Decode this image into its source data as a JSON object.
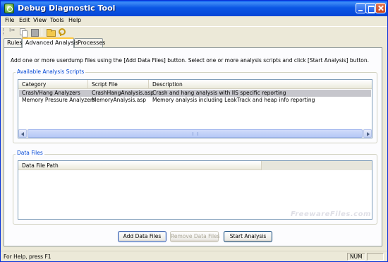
{
  "window": {
    "title": "Debug Diagnostic Tool"
  },
  "menu": [
    "File",
    "Edit",
    "View",
    "Tools",
    "Help"
  ],
  "toolbar": {
    "icons": [
      "cut-icon",
      "copy-icon",
      "paste-icon",
      "open-folder-icon",
      "key-icon"
    ]
  },
  "tabs": [
    "Rules",
    "Advanced Analysis",
    "Processes"
  ],
  "active_tab": "Advanced Analysis",
  "instructions": "Add one or more userdump files using the [Add Data Files] button. Select one or more analysis scripts and click [Start Analysis] button.",
  "scripts_group": {
    "label": "Available Analysis Scripts",
    "columns": [
      "Category",
      "Script File",
      "Description"
    ],
    "rows": [
      {
        "category": "Crash/Hang Analyzers",
        "script": "CrashHangAnalysis.asp",
        "description": "Crash and hang analysis with IIS specific reporting",
        "selected": true
      },
      {
        "category": "Memory Pressure Analyzers",
        "script": "MemoryAnalysis.asp",
        "description": "Memory analysis including LeakTrack and heap info reporting",
        "selected": false
      }
    ]
  },
  "files_group": {
    "label": "Data Files",
    "columns": [
      "Data File Path"
    ],
    "rows": []
  },
  "buttons": {
    "add": "Add Data Files",
    "remove": "Remove Data Files",
    "start": "Start Analysis"
  },
  "watermark": "FreewareFiles.com",
  "status": {
    "text": "For Help, press F1",
    "num": "NUM"
  },
  "colors": {
    "title_bar": "#0054e3",
    "group_label": "#0046d5",
    "selected_row": "#c6c6cc"
  }
}
